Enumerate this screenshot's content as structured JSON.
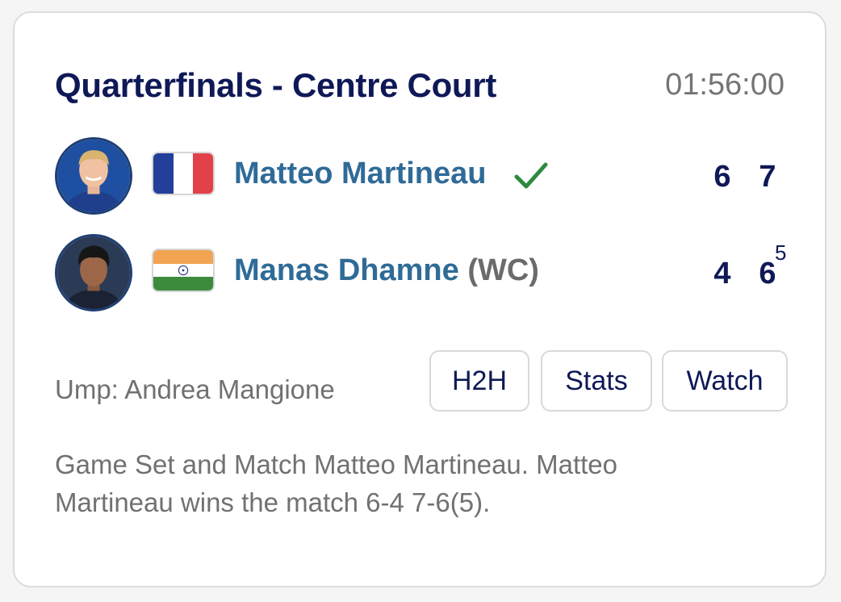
{
  "match": {
    "title": "Quarterfinals - Centre Court",
    "duration": "01:56:00"
  },
  "players": [
    {
      "name": "Matteo Martineau",
      "seed": "",
      "country_flag": "france-flag",
      "winner": true,
      "sets": [
        "6",
        "7"
      ],
      "tiebreak": ""
    },
    {
      "name": "Manas Dhamne",
      "seed": "(WC)",
      "country_flag": "india-flag",
      "winner": false,
      "sets": [
        "4",
        "6"
      ],
      "tiebreak": "5"
    }
  ],
  "umpire": "Ump: Andrea Mangione",
  "buttons": {
    "h2h": "H2H",
    "stats": "Stats",
    "watch": "Watch"
  },
  "summary": "Game Set and Match Matteo Martineau. Matteo Martineau wins the match 6-4 7-6(5).",
  "colors": {
    "title": "#0f1957",
    "player_name": "#2f6b97",
    "winner_check": "#2e8b3e",
    "muted_text": "#717171"
  }
}
